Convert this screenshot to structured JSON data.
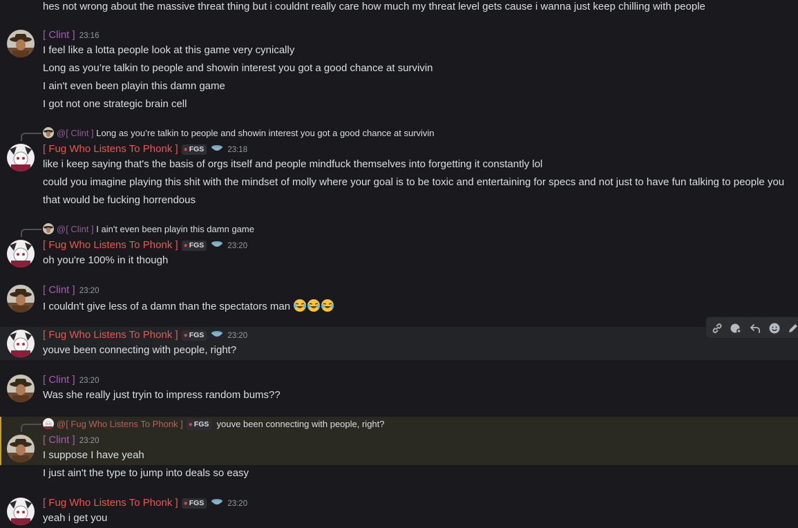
{
  "messages": {
    "top_line": "hes not wrong about the massive threat thing but i couldnt really care how much my threat level gets cause i wanna just keep chilling with people",
    "m1": {
      "author": "[ Clint ]",
      "time": "23:16",
      "lines": [
        "I feel like a lotta people look at this game very cynically",
        "Long as you’re talkin to people and showin interest you got a good chance at survivin",
        "I ain't even been playin this damn game",
        "I got not one strategic brain cell"
      ]
    },
    "m2": {
      "reply_author": "@[ Clint ]",
      "reply_text": "Long as you’re talkin to people and showin interest you got a good chance at survivin",
      "author": "[ Fug Who Listens To Phonk ]",
      "tag": "FGS",
      "time": "23:18",
      "lines": [
        "like i keep saying that's the basis of orgs itself and people mindfuck themselves into forgetting it constantly lol",
        "could you imagine playing this shit with the mindset of molly where your goal is to be toxic and entertaining for specs and not just to have fun talking to people you",
        "that would be fucking horrendous"
      ]
    },
    "m3": {
      "reply_author": "@[ Clint ]",
      "reply_text": "I ain't even been playin this damn game",
      "author": "[ Fug Who Listens To Phonk ]",
      "tag": "FGS",
      "time": "23:20",
      "lines": [
        "oh you're 100% in it though"
      ]
    },
    "m4": {
      "author": "[ Clint ]",
      "time": "23:20",
      "lines": [
        "I couldn't give less of a damn than the spectators man"
      ]
    },
    "m5": {
      "author": "[ Fug Who Listens To Phonk ]",
      "tag": "FGS",
      "time": "23:20",
      "lines": [
        "youve been connecting with people, right?"
      ]
    },
    "m6": {
      "author": "[ Clint ]",
      "time": "23:20",
      "lines": [
        "Was she really just tryin to impress random bums??"
      ]
    },
    "m7": {
      "reply_author": "@[ Fug Who Listens To Phonk ]",
      "reply_tag": "FGS",
      "reply_text": "youve been connecting with people, right?",
      "author": "[ Clint ]",
      "time": "23:20",
      "lines": [
        "I suppose I have yeah",
        "I just ain't the type to jump into deals so easy"
      ]
    },
    "m8": {
      "author": "[ Fug Who Listens To Phonk ]",
      "tag": "FGS",
      "time": "23:20",
      "lines": [
        "yeah i get you"
      ]
    }
  },
  "toolbar": {
    "icons": [
      "link-icon",
      "add-reaction-icon",
      "reply-icon",
      "emoji-icon",
      "edit-icon"
    ]
  },
  "colors": {
    "background": "#1a1a1e",
    "clint_name": "#a25fb0",
    "fug_name": "#e8584f",
    "mention_highlight": "#2b2a22"
  }
}
